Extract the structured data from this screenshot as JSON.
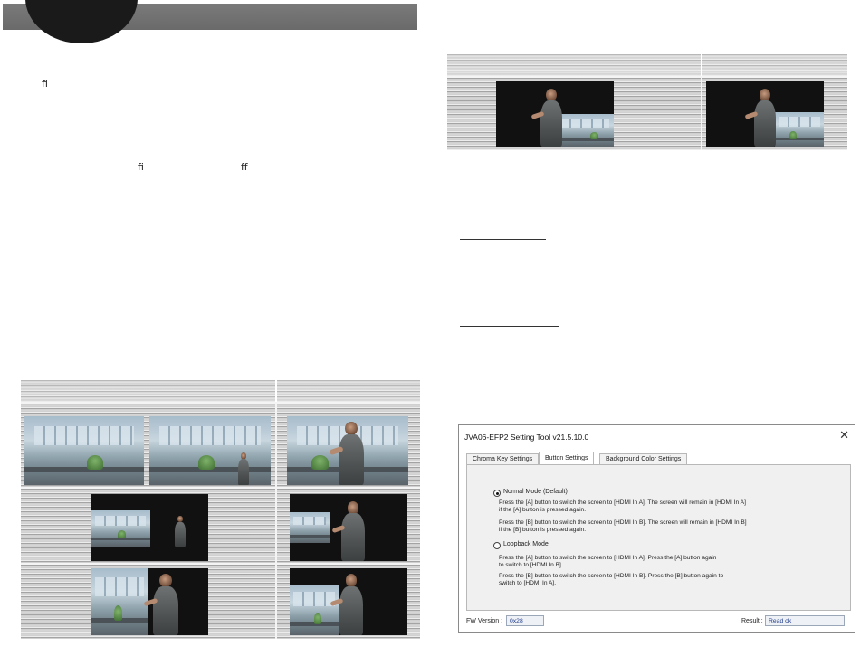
{
  "page": {
    "glyphs": [
      "ﬁ",
      "ﬁ",
      "ﬀ"
    ]
  },
  "dialog": {
    "title": "JVA06-EFP2 Setting Tool v21.5.10.0",
    "close_symbol": "✕",
    "tabs": [
      {
        "label": "Chroma Key Settings",
        "active": false
      },
      {
        "label": "Button Settings",
        "active": true
      },
      {
        "label": "Background Color Settings",
        "active": false
      }
    ],
    "options": [
      {
        "label": "Normal Mode (Default)",
        "selected": true,
        "lines": [
          "Press the [A] button to switch the screen to [HDMI In A]. The screen will remain in [HDMI In A]",
          "if the [A] button is pressed again.",
          "Press the [B] button to switch the screen to [HDMI In B]. The screen will remain in [HDMI In  B]",
          "if the [B] button is pressed again."
        ]
      },
      {
        "label": "Loopback Mode",
        "selected": false,
        "lines": [
          "Press the [A] button to switch the screen to [HDMI In A]. Press the [A] button again",
          "to switch to [HDMI In B].",
          "Press the [B] button to switch the screen to [HDMI In B]. Press the  [B] button again to",
          "switch to [HDMI In A]."
        ]
      }
    ],
    "fw_version_label": "FW Version :",
    "fw_version_value": "0x28",
    "result_label": "Result :",
    "result_value": "Read ok"
  },
  "colors": {
    "header_bar": "#6f6f6f",
    "header_circle": "#1a1a1a",
    "field_text": "#1f3b8a"
  }
}
